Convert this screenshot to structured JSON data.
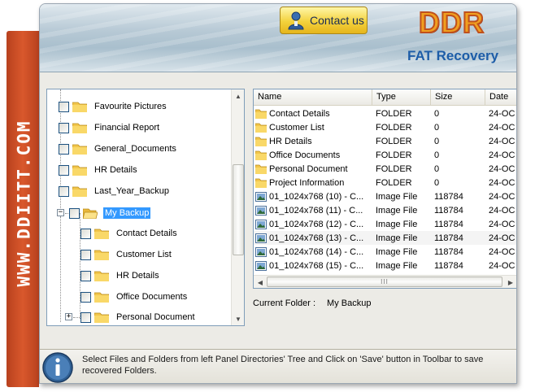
{
  "side_banner": {
    "text": "WWW.DDIITT.COM",
    "color": "#c94c25"
  },
  "header": {
    "contact_label": "Contact us",
    "brand": "DDR",
    "product": "FAT Recovery"
  },
  "tree": {
    "items": [
      {
        "label": "Favourite Pictures"
      },
      {
        "label": "Financial Report"
      },
      {
        "label": "General_Documents"
      },
      {
        "label": "HR Details"
      },
      {
        "label": "Last_Year_Backup"
      },
      {
        "label": "My Backup",
        "selected": true
      },
      {
        "label": "Contact Details"
      },
      {
        "label": "Customer List"
      },
      {
        "label": "HR Details"
      },
      {
        "label": "Office Documents"
      },
      {
        "label": "Personal Document"
      }
    ],
    "expanders": {
      "collapse": "−",
      "expand": "+"
    }
  },
  "list": {
    "columns": [
      "Name",
      "Type",
      "Size",
      "Date"
    ],
    "rows": [
      {
        "icon": "folder-icon",
        "name": "Contact Details",
        "type": "FOLDER",
        "size": "0",
        "date": "24-OC"
      },
      {
        "icon": "folder-icon",
        "name": "Customer List",
        "type": "FOLDER",
        "size": "0",
        "date": "24-OC"
      },
      {
        "icon": "folder-icon",
        "name": "HR Details",
        "type": "FOLDER",
        "size": "0",
        "date": "24-OC"
      },
      {
        "icon": "folder-icon",
        "name": "Office Documents",
        "type": "FOLDER",
        "size": "0",
        "date": "24-OC"
      },
      {
        "icon": "folder-icon",
        "name": "Personal Document",
        "type": "FOLDER",
        "size": "0",
        "date": "24-OC"
      },
      {
        "icon": "folder-icon",
        "name": "Project Information",
        "type": "FOLDER",
        "size": "0",
        "date": "24-OC"
      },
      {
        "icon": "image-file-icon",
        "name": "01_1024x768 (10) - C...",
        "type": "Image File",
        "size": "118784",
        "date": "24-OC"
      },
      {
        "icon": "image-file-icon",
        "name": "01_1024x768 (11) - C...",
        "type": "Image File",
        "size": "118784",
        "date": "24-OC"
      },
      {
        "icon": "image-file-icon",
        "name": "01_1024x768 (12) - C...",
        "type": "Image File",
        "size": "118784",
        "date": "24-OC"
      },
      {
        "icon": "image-file-icon",
        "name": "01_1024x768 (13) - C...",
        "type": "Image File",
        "size": "118784",
        "date": "24-OC"
      },
      {
        "icon": "image-file-icon",
        "name": "01_1024x768 (14) - C...",
        "type": "Image File",
        "size": "118784",
        "date": "24-OC"
      },
      {
        "icon": "image-file-icon",
        "name": "01_1024x768 (15) - C...",
        "type": "Image File",
        "size": "118784",
        "date": "24-OC"
      }
    ],
    "scroll_grip": "III"
  },
  "current_folder": {
    "label": "Current Folder :",
    "value": "My Backup"
  },
  "status": {
    "message": "Select Files and Folders from left Panel Directories' Tree and Click on 'Save' button in Toolbar to save recovered Folders."
  }
}
